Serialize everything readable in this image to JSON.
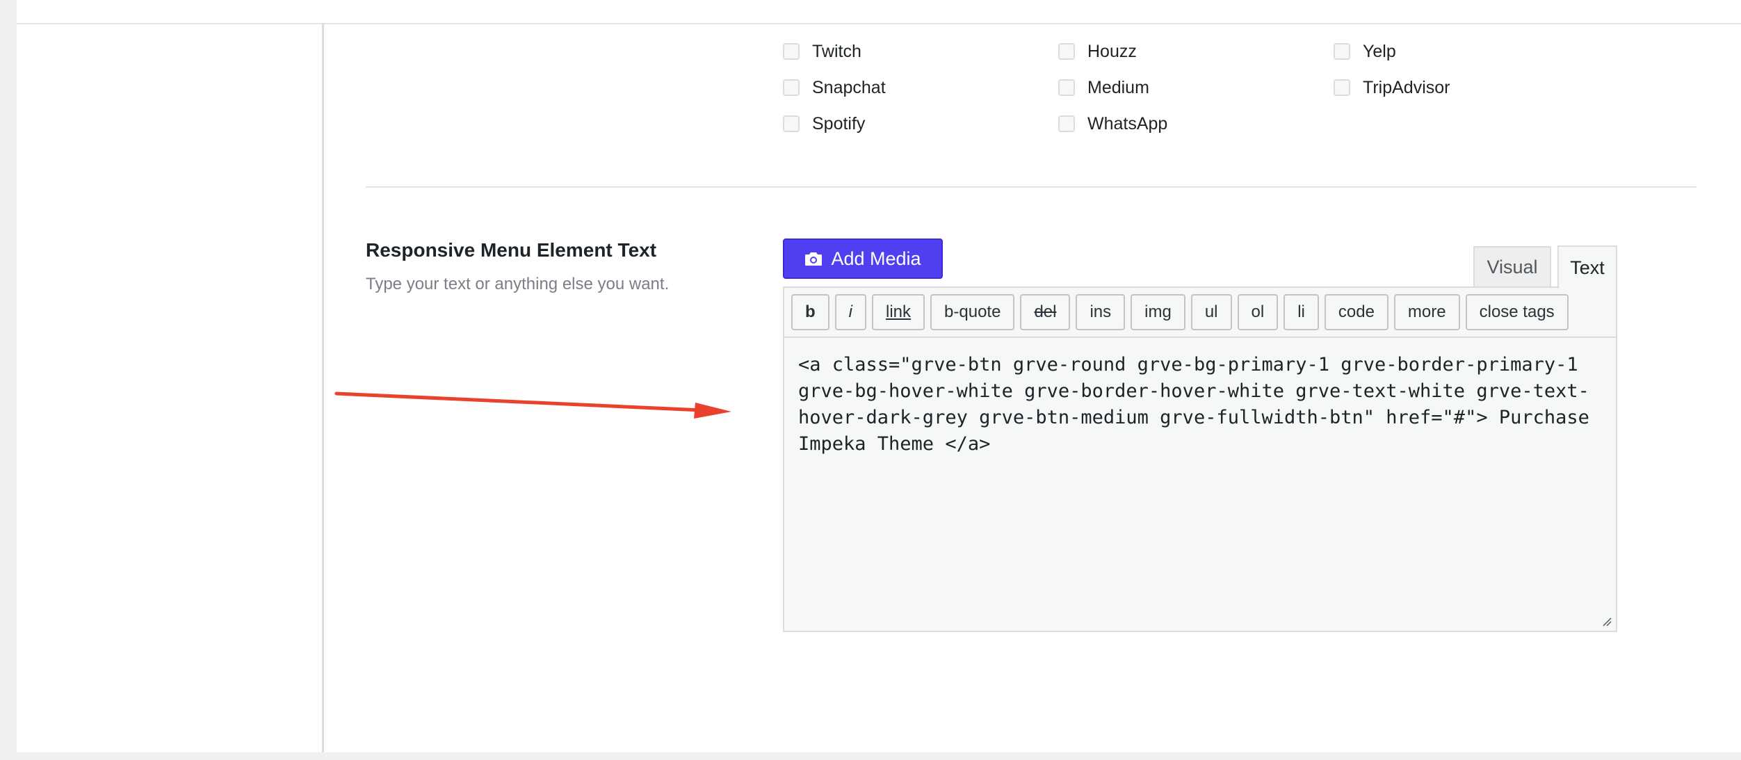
{
  "social": {
    "items": [
      {
        "label": "Twitch"
      },
      {
        "label": "Houzz"
      },
      {
        "label": "Yelp"
      },
      {
        "label": "Snapchat"
      },
      {
        "label": "Medium"
      },
      {
        "label": "TripAdvisor"
      },
      {
        "label": "Spotify"
      },
      {
        "label": "WhatsApp"
      }
    ]
  },
  "field": {
    "title": "Responsive Menu Element Text",
    "description": "Type your text or anything else you want."
  },
  "editor": {
    "add_media_label": "Add Media",
    "tabs": {
      "visual": "Visual",
      "text": "Text"
    },
    "toolbar": [
      "b",
      "i",
      "link",
      "b-quote",
      "del",
      "ins",
      "img",
      "ul",
      "ol",
      "li",
      "code",
      "more",
      "close tags"
    ],
    "content": "<a class=\"grve-btn grve-round grve-bg-primary-1 grve-border-primary-1 grve-bg-hover-white grve-border-hover-white grve-text-white grve-text-hover-dark-grey grve-btn-medium grve-fullwidth-btn\" href=\"#\"> Purchase Impeka Theme </a>"
  },
  "colors": {
    "accent": "#4f3ff0",
    "arrow": "#e8412c"
  },
  "icons": {
    "add_media": "camera-icon",
    "annotation": "red-arrow"
  }
}
